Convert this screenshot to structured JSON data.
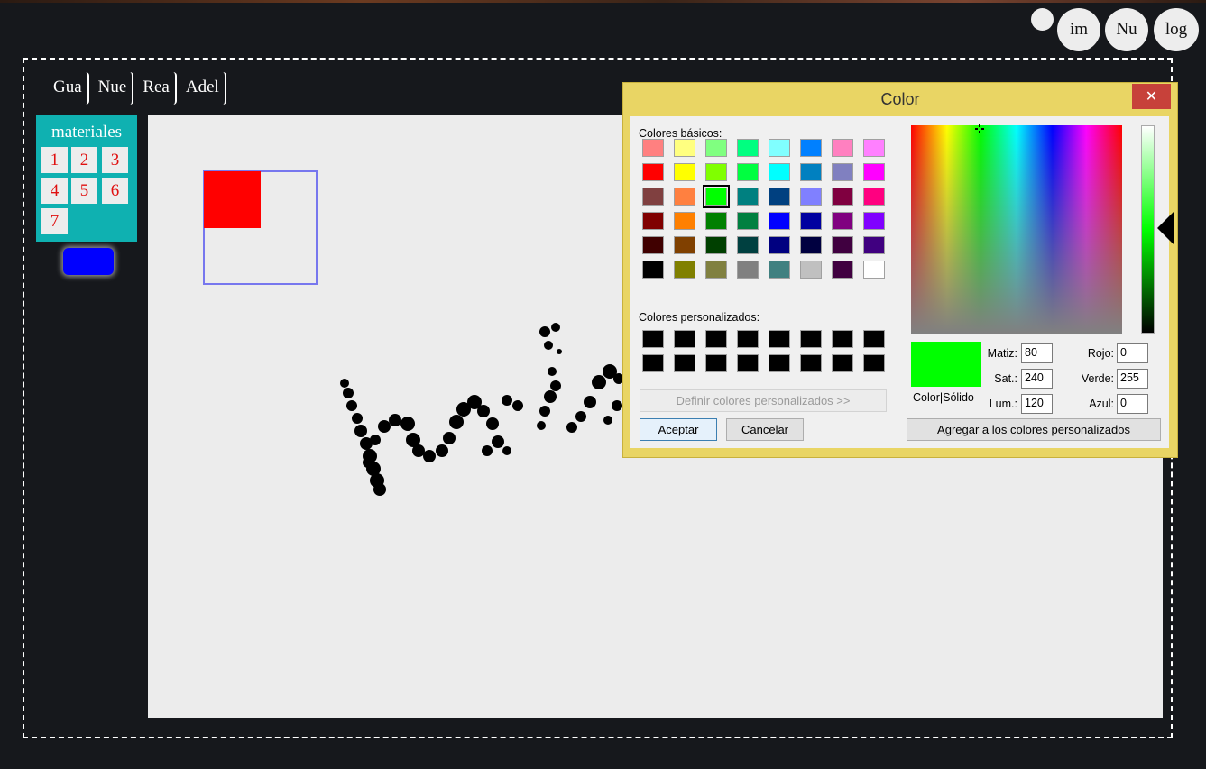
{
  "top_buttons": {
    "small": "",
    "im": "im",
    "nu": "Nu",
    "log": "log"
  },
  "menu": [
    "Gua",
    "Nue",
    "Rea",
    "Adel"
  ],
  "materials": {
    "title": "materiales",
    "items": [
      "1",
      "2",
      "3",
      "4",
      "5",
      "6",
      "7"
    ]
  },
  "canvas": {
    "background": "#ececec",
    "selected_material_color": "#0000ff",
    "square_color": "#ff0000",
    "outline_color": "#7777ee"
  },
  "dialog": {
    "title": "Color",
    "close": "✕",
    "basic_label": "Colores básicos:",
    "custom_label": "Colores personalizados:",
    "define_custom": "Definir colores personalizados >>",
    "accept": "Aceptar",
    "cancel": "Cancelar",
    "color_solid": "Color|Sólido",
    "add_custom": "Agregar a los colores personalizados",
    "hue_label": "Matiz:",
    "hue": "80",
    "sat_label": "Sat.:",
    "sat": "240",
    "lum_label": "Lum.:",
    "lum": "120",
    "red_label": "Rojo:",
    "red": "0",
    "green_label": "Verde:",
    "green": "255",
    "blue_label": "Azul:",
    "blue": "0",
    "selected_color": "#00ff00",
    "basic_colors": [
      "#ff8080",
      "#ffff80",
      "#80ff80",
      "#00ff80",
      "#80ffff",
      "#0080ff",
      "#ff80c0",
      "#ff80ff",
      "#ff0000",
      "#ffff00",
      "#80ff00",
      "#00ff40",
      "#00ffff",
      "#0080c0",
      "#8080c0",
      "#ff00ff",
      "#804040",
      "#ff8040",
      "#00ff00",
      "#008080",
      "#004080",
      "#8080ff",
      "#800040",
      "#ff0080",
      "#800000",
      "#ff8000",
      "#008000",
      "#008040",
      "#0000ff",
      "#0000a0",
      "#800080",
      "#8000ff",
      "#400000",
      "#804000",
      "#004000",
      "#004040",
      "#000080",
      "#000040",
      "#400040",
      "#400080",
      "#000000",
      "#808000",
      "#808040",
      "#808080",
      "#408080",
      "#c0c0c0",
      "#400040",
      "#ffffff"
    ],
    "selected_basic_index": 18,
    "custom_colors": [
      "#000000",
      "#000000",
      "#000000",
      "#000000",
      "#000000",
      "#000000",
      "#000000",
      "#000000",
      "#000000",
      "#000000",
      "#000000",
      "#000000",
      "#000000",
      "#000000",
      "#000000",
      "#000000"
    ]
  }
}
